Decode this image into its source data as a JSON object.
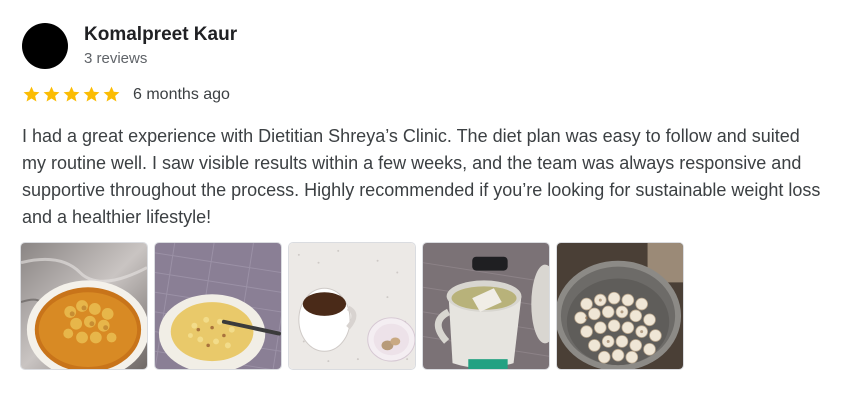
{
  "reviewer": {
    "name": "Komalpreet Kaur",
    "review_count": "3 reviews"
  },
  "rating": {
    "stars": 5,
    "max_stars": 5,
    "star_color": "#fbbc04",
    "time_ago": "6 months ago"
  },
  "review": {
    "text": "I had a great experience with Dietitian Shreya’s Clinic. The diet plan was easy to follow and suited my routine well. I saw visible results within a few weeks, and the team was always responsive and supportive throughout the process. Highly recommended if you’re looking for sustainable weight loss and a healthier lifestyle!"
  },
  "photos": [
    {
      "icon": "food-bowl-curry-photo"
    },
    {
      "icon": "food-plate-poha-photo"
    },
    {
      "icon": "tea-cup-snack-photo"
    },
    {
      "icon": "green-tea-mug-photo"
    },
    {
      "icon": "makhana-pot-photo"
    }
  ]
}
